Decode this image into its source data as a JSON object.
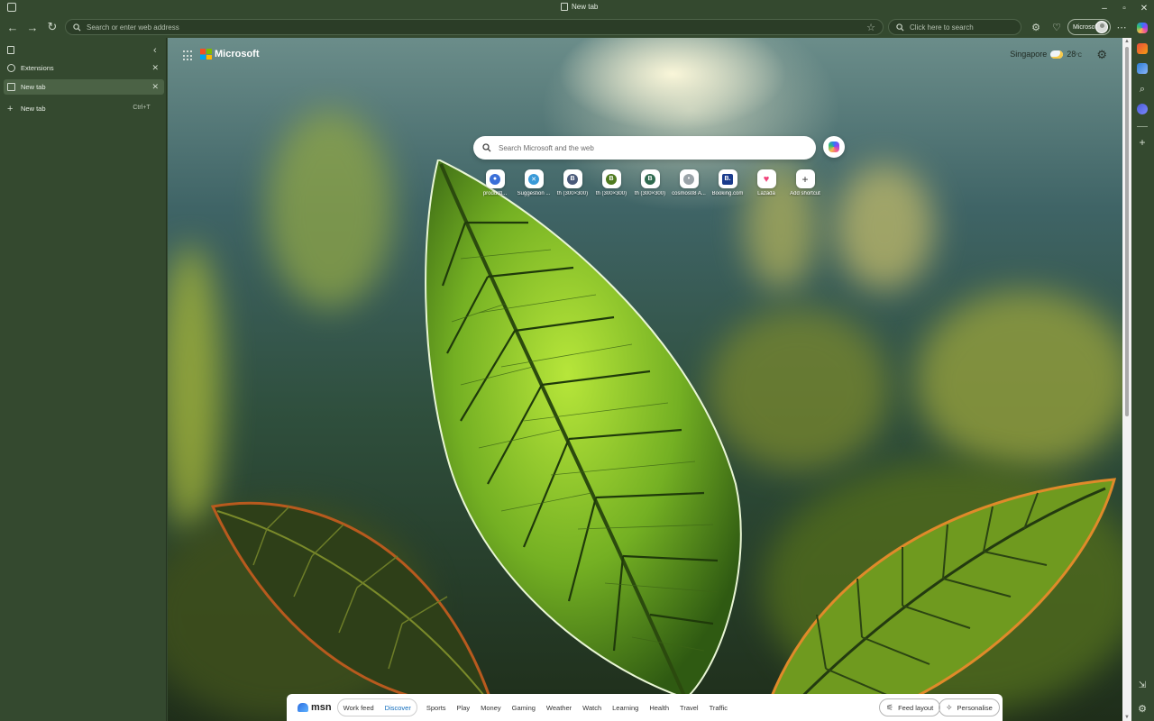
{
  "window": {
    "tab_title": "New tab",
    "controls": [
      "–",
      "▫",
      "✕"
    ]
  },
  "toolbar": {
    "address_placeholder": "Search or enter web address",
    "search_placeholder": "Click here to search",
    "profile_label": "Microsoft"
  },
  "sidebar": {
    "tabs": [
      {
        "label": "Extensions",
        "close": "✕"
      },
      {
        "label": "New tab",
        "close": "✕"
      }
    ],
    "new_tab_label": "New tab",
    "new_tab_shortcut": "Ctrl+T"
  },
  "ntp": {
    "brand": "Microsoft",
    "location": "Singapore",
    "temperature": "28",
    "temp_unit": "°C",
    "search_placeholder": "Search Microsoft and the web",
    "shortcuts": [
      {
        "label": "productl...",
        "glyph": "●",
        "color": "#3a6fd8"
      },
      {
        "label": "Suggestion ...",
        "glyph": "✕",
        "color": "#3a9ad8"
      },
      {
        "label": "th (300×300)",
        "glyph": "B",
        "color": "#4a5a7a"
      },
      {
        "label": "th (300×300)",
        "glyph": "B",
        "color": "#4f7a1f"
      },
      {
        "label": "th (300×300)",
        "glyph": "B",
        "color": "#2f6a4f"
      },
      {
        "label": "cosmos08 A...",
        "glyph": "•",
        "color": "#9aa3a8"
      },
      {
        "label": "Booking.com",
        "glyph": "B.",
        "color": "#1a3b8c"
      },
      {
        "label": "Lazada",
        "glyph": "♥",
        "color": "#f0437a"
      },
      {
        "label": "Add shortcut",
        "glyph": "+",
        "color": "#ffffff"
      }
    ]
  },
  "feed": {
    "brand": "msn",
    "segments": [
      "Work feed",
      "Discover"
    ],
    "active_segment": "Discover",
    "links": [
      "Sports",
      "Play",
      "Money",
      "Gaming",
      "Weather",
      "Watch",
      "Learning",
      "Health",
      "Travel",
      "Traffic"
    ],
    "feed_layout_label": "Feed layout",
    "personalise_label": "Personalise"
  },
  "colors": {
    "frame": "#34492f",
    "active_tab": "#4b6245",
    "accent_link": "#0f6cbd"
  }
}
